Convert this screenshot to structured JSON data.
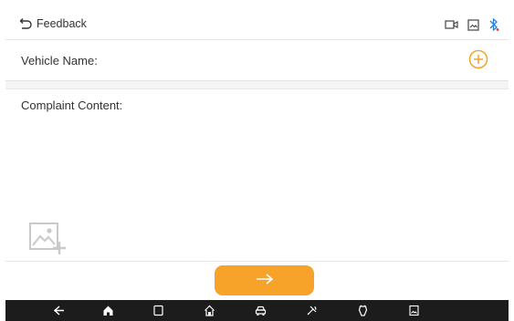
{
  "header": {
    "title": "Feedback",
    "icons": [
      "back-arrow-icon",
      "video-record-icon",
      "screenshot-icon",
      "bluetooth-icon"
    ]
  },
  "form": {
    "vehicle_name_label": "Vehicle Name:",
    "complaint_content_label": "Complaint Content:"
  },
  "actions": {
    "next_icon": "arrow-right-icon"
  },
  "nav_bar": {
    "icons": [
      "back-icon",
      "home-icon",
      "recent-apps-icon",
      "diagnostic-home-icon",
      "vehicle-icon",
      "tools-icon",
      "vci-icon",
      "screenshot-icon"
    ]
  },
  "colors": {
    "accent": "#f7a32a",
    "bluetooth": "#2a7fd6",
    "nav_bar_bg": "#1c1c1c"
  }
}
